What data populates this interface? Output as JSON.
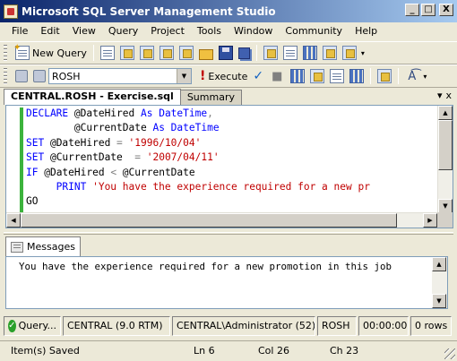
{
  "window": {
    "title": "Microsoft SQL Server Management Studio",
    "controls": {
      "minimize": "_",
      "maximize": "□",
      "close": "X"
    }
  },
  "menu": [
    "File",
    "Edit",
    "View",
    "Query",
    "Project",
    "Tools",
    "Window",
    "Community",
    "Help"
  ],
  "toolbar": {
    "new_query_label": "New Query",
    "database_combo_value": "ROSH",
    "execute_label": "Execute"
  },
  "tabs": {
    "active": "CENTRAL.ROSH - Exercise.sql",
    "inactive": "Summary",
    "pin": "▾",
    "close": "x"
  },
  "editor": {
    "lines": [
      [
        {
          "t": "DECLARE ",
          "c": "kw"
        },
        {
          "t": "@DateHired ",
          "c": ""
        },
        {
          "t": "As ",
          "c": "kw"
        },
        {
          "t": "DateTime",
          "c": "kw"
        },
        {
          "t": ",",
          "c": "op"
        }
      ],
      [
        {
          "t": "        @CurrentDate ",
          "c": ""
        },
        {
          "t": "As ",
          "c": "kw"
        },
        {
          "t": "DateTime",
          "c": "kw"
        }
      ],
      [
        {
          "t": "SET ",
          "c": "kw"
        },
        {
          "t": "@DateHired ",
          "c": ""
        },
        {
          "t": "= ",
          "c": "op"
        },
        {
          "t": "'1996/10/04'",
          "c": "str"
        }
      ],
      [
        {
          "t": "SET ",
          "c": "kw"
        },
        {
          "t": "@CurrentDate  ",
          "c": ""
        },
        {
          "t": "= ",
          "c": "op"
        },
        {
          "t": "'2007/04/11'",
          "c": "str"
        }
      ],
      [
        {
          "t": "IF ",
          "c": "kw"
        },
        {
          "t": "@DateHired ",
          "c": ""
        },
        {
          "t": "< ",
          "c": "op"
        },
        {
          "t": "@CurrentDate",
          "c": ""
        }
      ],
      [
        {
          "t": "     PRINT ",
          "c": "kw"
        },
        {
          "t": "'You have the experience required for a new pr",
          "c": "str"
        }
      ],
      [
        {
          "t": "GO",
          "c": ""
        }
      ]
    ]
  },
  "results": {
    "tab_label": "Messages",
    "message": "You have the experience required for a new promotion in this job"
  },
  "query_status": {
    "state": "Query...",
    "server": "CENTRAL (9.0 RTM)",
    "user": "CENTRAL\\Administrator (52)",
    "database": "ROSH",
    "elapsed": "00:00:00",
    "rows": "0 rows"
  },
  "status": {
    "message": "Item(s) Saved",
    "ln": "Ln 6",
    "col": "Col 26",
    "ch": "Ch 23"
  },
  "colors": {
    "keyword": "#0000ff",
    "string": "#c00000",
    "change_bar": "#3cb33c",
    "title_start": "#0a246a",
    "title_end": "#a6caf0"
  }
}
